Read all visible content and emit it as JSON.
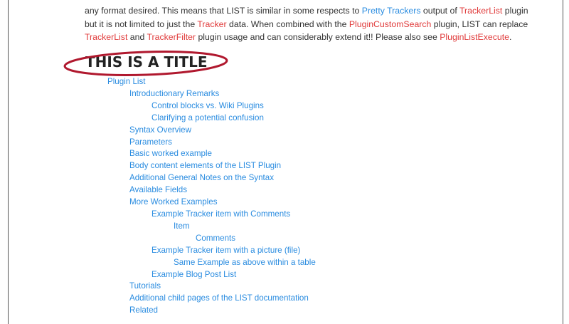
{
  "paragraph": {
    "l1_t1": "any format desired. This means that LIST is similar in some respects to ",
    "l1_link1": "Pretty Trackers",
    "l1_t2": " output of ",
    "l1_link2": "TrackerList",
    "l1_t3": " plugin",
    "l2_t1": "but it is not limited to just the ",
    "l2_link1": "Tracker",
    "l2_t2": " data. When combined with the ",
    "l2_link2": "PluginCustomSearch",
    "l2_t3": " plugin, LIST can replace",
    "l3_link1": "TrackerList",
    "l3_t1": " and ",
    "l3_link2": "TrackerFilter",
    "l3_t2": " plugin usage and can considerably extend it!! Please also see ",
    "l3_link3": "PluginListExecute",
    "l3_t3": "."
  },
  "title": "THIS IS A TITLE",
  "colors": {
    "link_blue": "#2a8ce0",
    "link_red": "#e03a3a",
    "annotation_red": "#b0182e",
    "text": "#333333"
  },
  "toc": [
    {
      "label": "Plugin List",
      "level": 1
    },
    {
      "label": "Introductionary Remarks",
      "level": 2
    },
    {
      "label": "Control blocks vs. Wiki Plugins",
      "level": 3
    },
    {
      "label": "Clarifying a potential confusion",
      "level": 3
    },
    {
      "label": "Syntax Overview",
      "level": 2
    },
    {
      "label": "Parameters",
      "level": 2
    },
    {
      "label": "Basic worked example",
      "level": 2
    },
    {
      "label": "Body content elements of the LIST Plugin",
      "level": 2
    },
    {
      "label": "Additional General Notes on the Syntax",
      "level": 2
    },
    {
      "label": "Available Fields",
      "level": 2
    },
    {
      "label": "More Worked Examples",
      "level": 2
    },
    {
      "label": "Example Tracker item with Comments",
      "level": 3
    },
    {
      "label": "Item",
      "level": 4
    },
    {
      "label": "Comments",
      "level": 5
    },
    {
      "label": "Example Tracker item with a picture (file)",
      "level": 3
    },
    {
      "label": "Same Example as above within a table",
      "level": 4
    },
    {
      "label": "Example Blog Post List",
      "level": 3
    },
    {
      "label": "Tutorials",
      "level": 2
    },
    {
      "label": "Additional child pages of the LIST documentation",
      "level": 2
    },
    {
      "label": "Related",
      "level": 2
    }
  ]
}
